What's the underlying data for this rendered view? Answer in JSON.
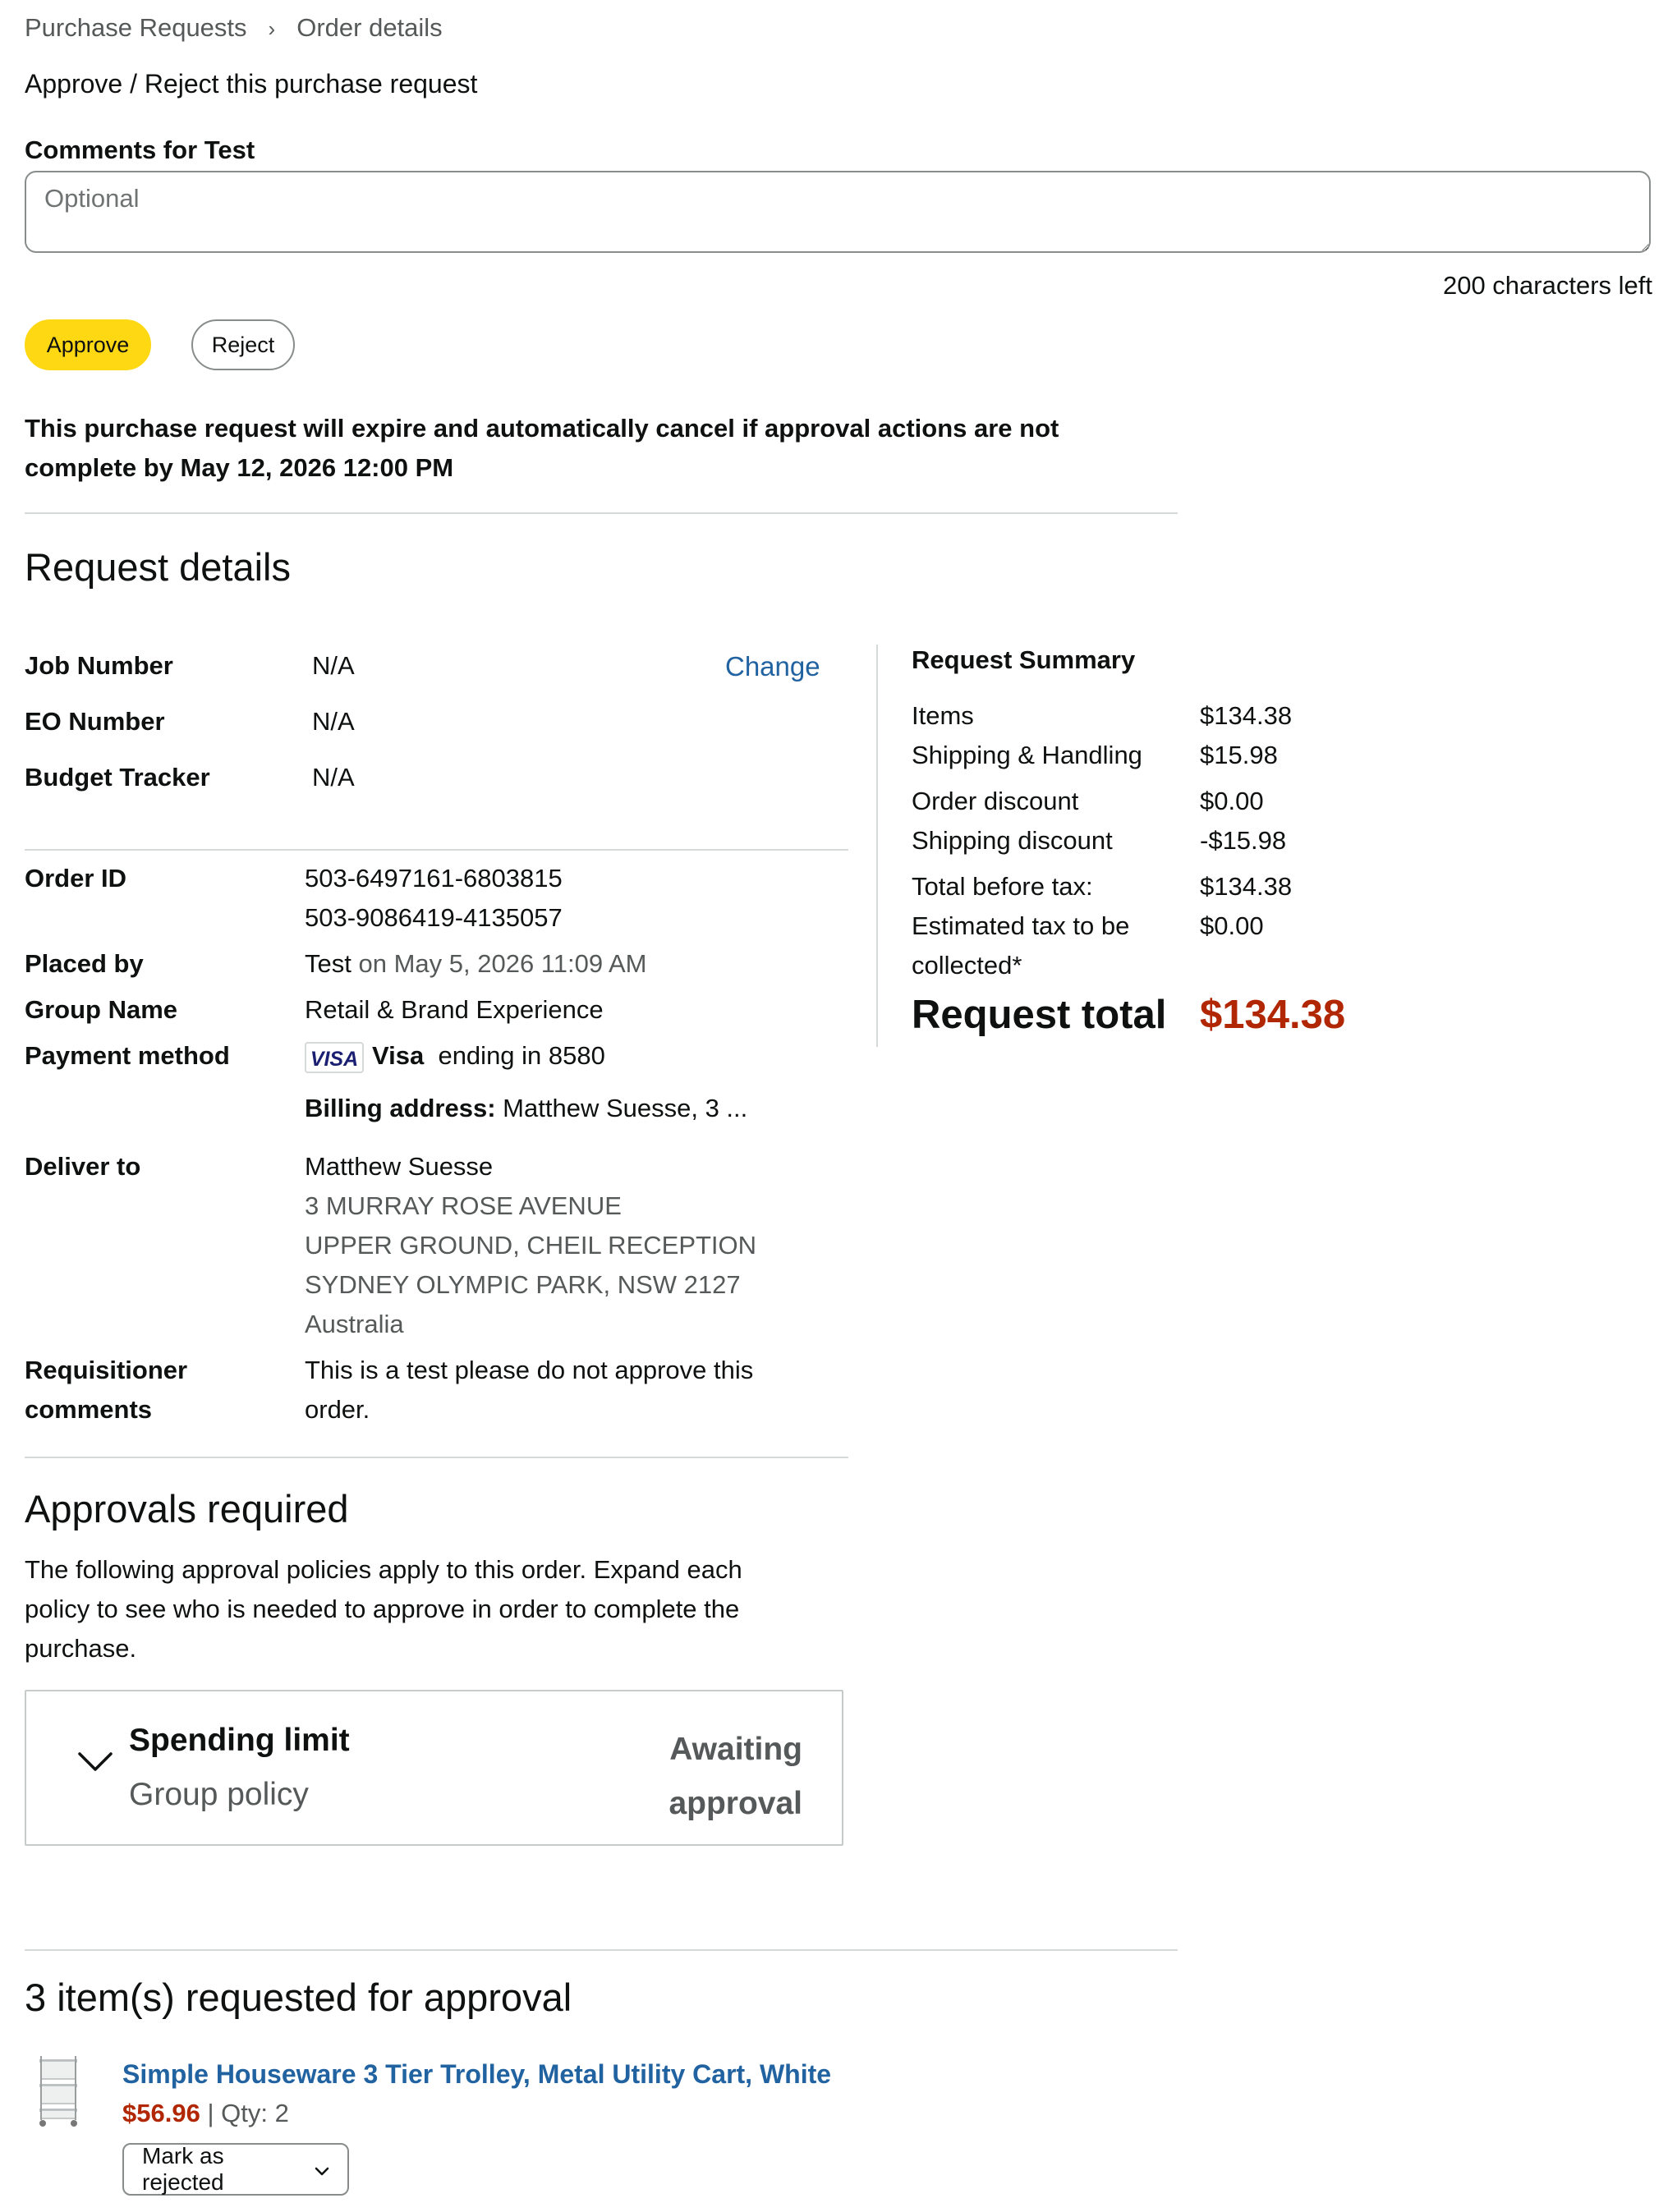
{
  "breadcrumb": {
    "parent": "Purchase Requests",
    "separator": "›",
    "current": "Order details"
  },
  "page_title": "Approve / Reject this purchase request",
  "comments": {
    "label": "Comments for Test",
    "placeholder": "Optional",
    "value": "",
    "chars_left": "200 characters left"
  },
  "actions": {
    "approve_label": "Approve",
    "reject_label": "Reject"
  },
  "expire_note": "This purchase request will expire and automatically cancel if approval actions are not complete by May 12, 2026 12:00 PM",
  "request_details": {
    "title": "Request details",
    "change_label": "Change",
    "fields": {
      "job_number": {
        "label": "Job Number",
        "value": "N/A"
      },
      "eo_number": {
        "label": "EO Number",
        "value": "N/A"
      },
      "budget_tracker": {
        "label": "Budget Tracker",
        "value": "N/A"
      },
      "order_id": {
        "label": "Order ID",
        "values": [
          "503-6497161-6803815",
          "503-9086419-4135057"
        ]
      },
      "placed_by": {
        "label": "Placed by",
        "name": "Test",
        "date": "on May 5, 2026 11:09 AM"
      },
      "group_name": {
        "label": "Group Name",
        "value": "Retail & Brand Experience"
      },
      "payment_method": {
        "label": "Payment method",
        "card_logo": "VISA",
        "card_brand": "Visa",
        "card_ending": "ending in 8580",
        "billing_label": "Billing address:",
        "billing_value": "Matthew Suesse, 3 ..."
      },
      "deliver_to": {
        "label": "Deliver to",
        "name": "Matthew Suesse",
        "lines": [
          "3 MURRAY ROSE AVENUE",
          "UPPER GROUND, CHEIL RECEPTION",
          "SYDNEY OLYMPIC PARK, NSW 2127",
          "Australia"
        ]
      },
      "requisitioner_comments": {
        "label_line1": "Requisitioner",
        "label_line2": "comments",
        "value_line1": "This is a test please do not approve this",
        "value_line2": "order."
      }
    }
  },
  "request_summary": {
    "title": "Request Summary",
    "rows": [
      {
        "label": "Items",
        "value": "$134.38"
      },
      {
        "label": "Shipping & Handling",
        "value": "$15.98"
      },
      {
        "label": "Order discount",
        "value": "$0.00"
      },
      {
        "label": "Shipping discount",
        "value": "-$15.98"
      },
      {
        "label": "Total before tax:",
        "value": "$134.38"
      },
      {
        "label": "Estimated tax to be",
        "label2": "collected*",
        "value": "$0.00"
      }
    ],
    "total_label": "Request total",
    "total_value": "$134.38"
  },
  "approvals": {
    "title": "Approvals required",
    "description": "The following approval policies apply to this order. Expand each policy to see who is needed to approve in order to complete the purchase.",
    "policies": [
      {
        "name": "Spending limit",
        "type": "Group policy",
        "status_line1": "Awaiting",
        "status_line2": "approval"
      }
    ]
  },
  "items": {
    "title": "3 item(s) requested for approval",
    "list": [
      {
        "title": "Simple Houseware 3 Tier Trolley, Metal Utility Cart, White",
        "price": "$56.96",
        "separator": "|",
        "qty": "Qty: 2",
        "action_label": "Mark as rejected"
      }
    ]
  },
  "colors": {
    "approve_button": "#ffd814",
    "link": "#2162a1",
    "price": "#b12704",
    "border": "#d5d9d9"
  }
}
